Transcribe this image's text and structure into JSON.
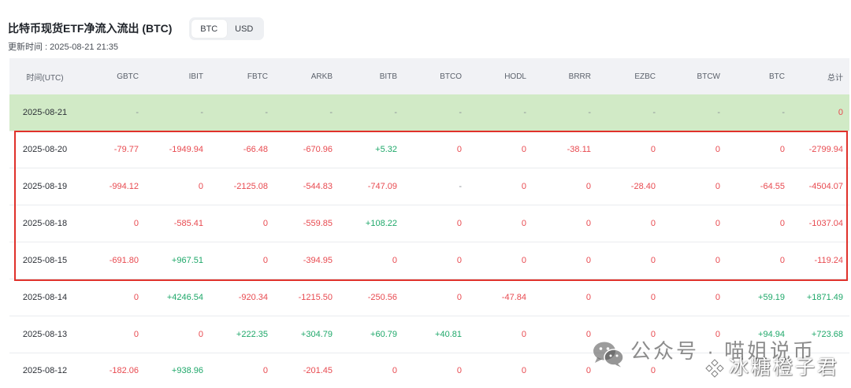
{
  "header": {
    "title": "比特币现货ETF净流入流出 (BTC)",
    "updated": "更新时间 : 2025-08-21 21:35",
    "toggle": [
      {
        "label": "BTC",
        "selected": true
      },
      {
        "label": "USD",
        "selected": false
      }
    ]
  },
  "table": {
    "columns": [
      "时间(UTC)",
      "GBTC",
      "IBIT",
      "FBTC",
      "ARKB",
      "BITB",
      "BTCO",
      "HODL",
      "BRRR",
      "EZBC",
      "BTCW",
      "BTC",
      "总计"
    ],
    "rows": [
      {
        "date": "2025-08-21",
        "highlight": true,
        "values": [
          "-",
          "-",
          "-",
          "-",
          "-",
          "-",
          "-",
          "-",
          "-",
          "-",
          "-",
          "0"
        ]
      },
      {
        "date": "2025-08-20",
        "values": [
          "-79.77",
          "-1949.94",
          "-66.48",
          "-670.96",
          "+5.32",
          "0",
          "0",
          "-38.11",
          "0",
          "0",
          "0",
          "-2799.94"
        ]
      },
      {
        "date": "2025-08-19",
        "values": [
          "-994.12",
          "0",
          "-2125.08",
          "-544.83",
          "-747.09",
          "-",
          "0",
          "0",
          "-28.40",
          "0",
          "-64.55",
          "-4504.07"
        ]
      },
      {
        "date": "2025-08-18",
        "values": [
          "0",
          "-585.41",
          "0",
          "-559.85",
          "+108.22",
          "0",
          "0",
          "0",
          "0",
          "0",
          "0",
          "-1037.04"
        ]
      },
      {
        "date": "2025-08-15",
        "values": [
          "-691.80",
          "+967.51",
          "0",
          "-394.95",
          "0",
          "0",
          "0",
          "0",
          "0",
          "0",
          "0",
          "-119.24"
        ]
      },
      {
        "date": "2025-08-14",
        "values": [
          "0",
          "+4246.54",
          "-920.34",
          "-1215.50",
          "-250.56",
          "0",
          "-47.84",
          "0",
          "0",
          "0",
          "+59.19",
          "+1871.49"
        ]
      },
      {
        "date": "2025-08-13",
        "values": [
          "0",
          "0",
          "+222.35",
          "+304.79",
          "+60.79",
          "+40.81",
          "0",
          "0",
          "0",
          "0",
          "+94.94",
          "+723.68"
        ]
      },
      {
        "date": "2025-08-12",
        "values": [
          "-182.06",
          "+938.96",
          "0",
          "-201.45",
          "0",
          "0",
          "0",
          "0",
          "0",
          "",
          "",
          ""
        ]
      }
    ]
  },
  "watermark": {
    "line1": "公众号 · 喵姐说币",
    "line2": "冰糖橙子君",
    "icon1": "wechat-icon",
    "icon2": "diamond-logo-icon"
  },
  "colors": {
    "negative": "#e84a50",
    "positive": "#1fa86a",
    "dash": "#8a8f97",
    "row_highlight": "#d1eac6",
    "header_bg": "#f1f2f5",
    "annotation": "#e0312b"
  }
}
